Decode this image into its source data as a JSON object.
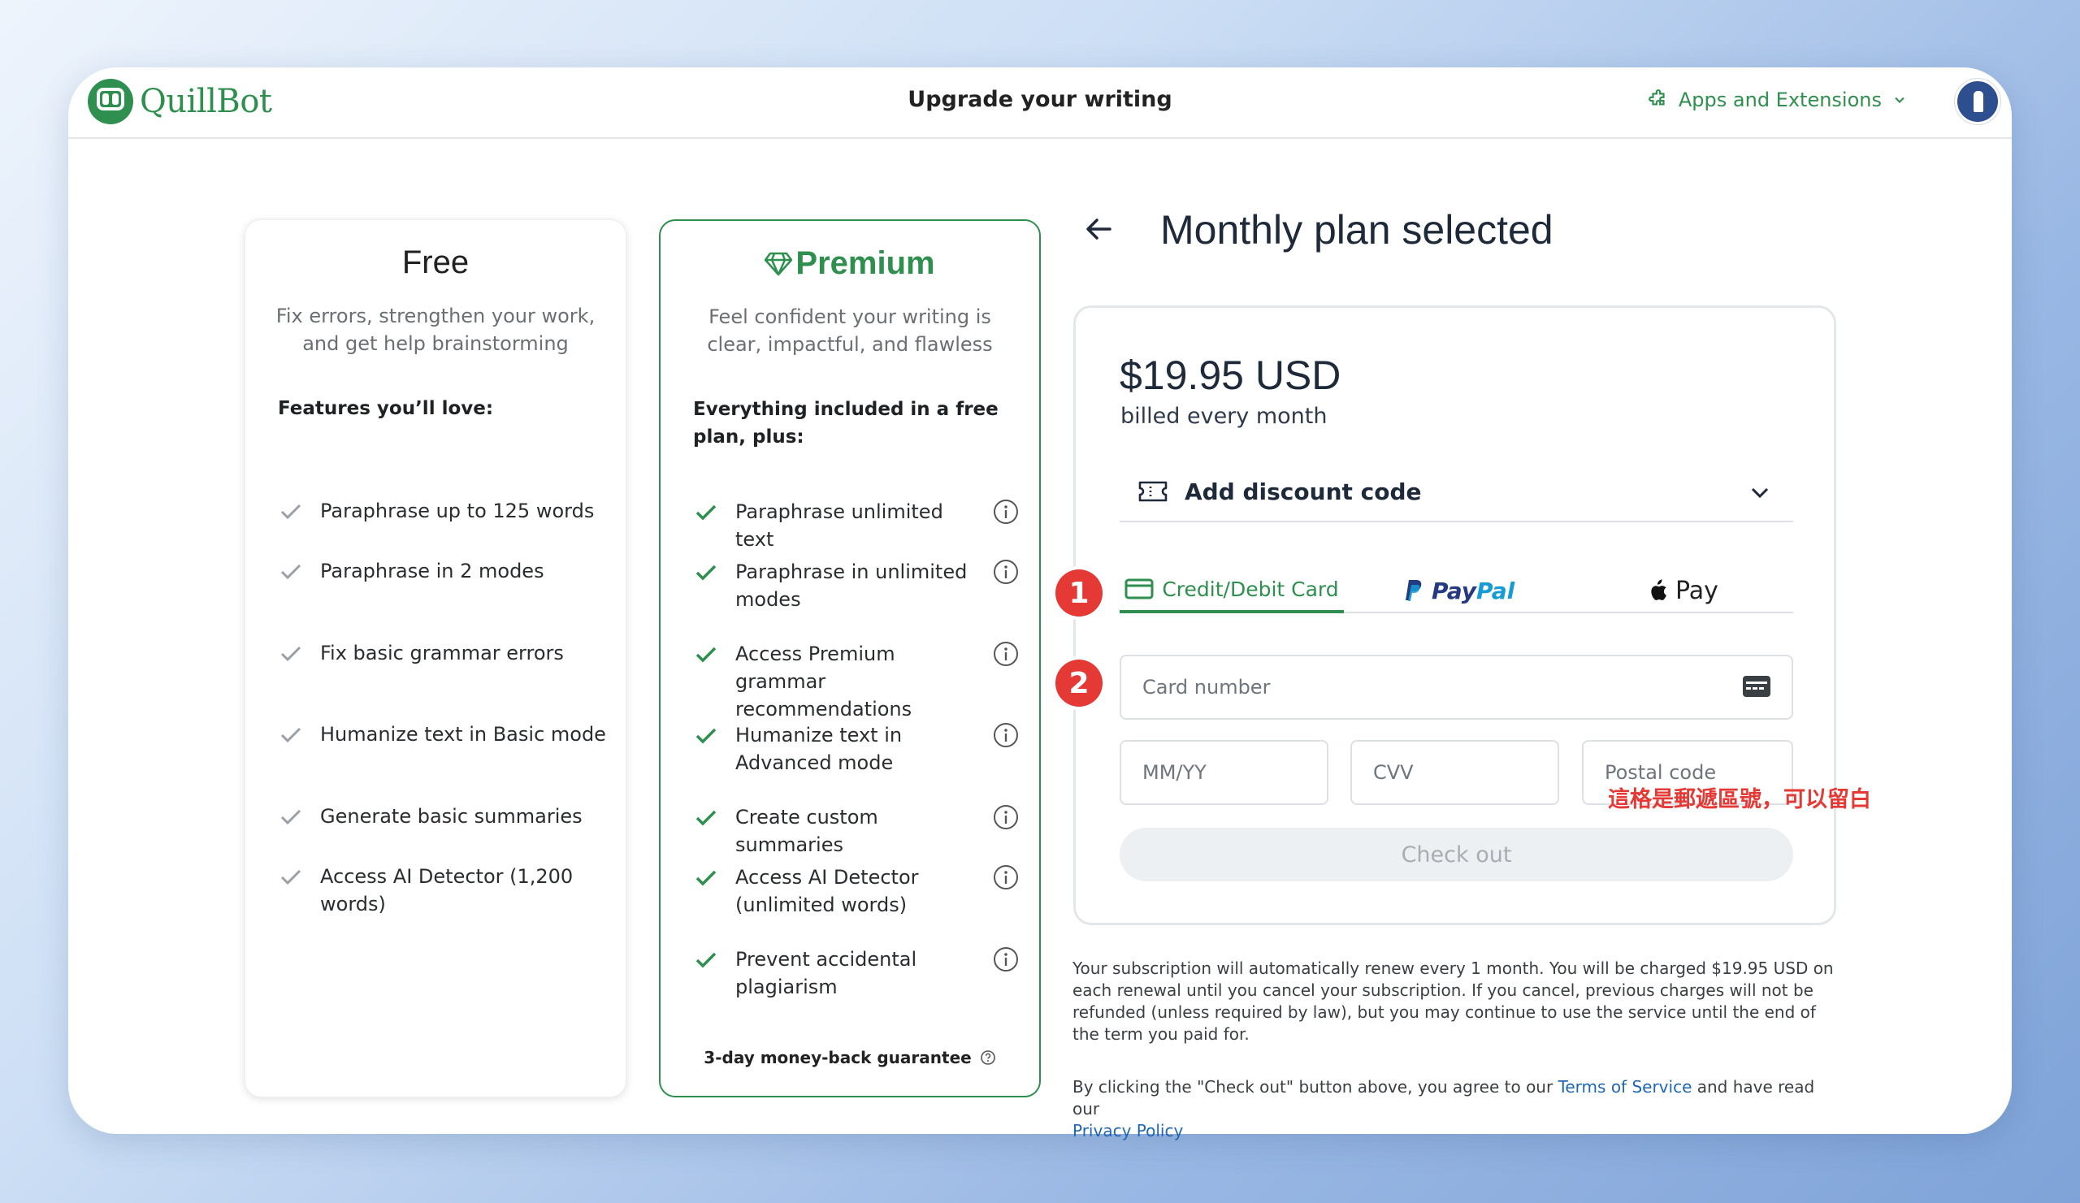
{
  "header": {
    "brand": "QuillBot",
    "title": "Upgrade your writing",
    "apps_label": "Apps and Extensions"
  },
  "free_plan": {
    "name": "Free",
    "description": "Fix errors, strengthen your work, and get help brainstorming",
    "lead": "Features you’ll love:",
    "features": [
      "Paraphrase up to 125 words",
      "Paraphrase in 2 modes",
      "Fix basic grammar errors",
      "Humanize text in Basic mode",
      "Generate basic summaries",
      "Access AI Detector (1,200 words)"
    ]
  },
  "premium_plan": {
    "name": "Premium",
    "description": "Feel confident your writing is clear, impactful, and flawless",
    "lead": "Everything included in a free plan, plus:",
    "features": [
      "Paraphrase unlimited text",
      "Paraphrase in unlimited modes",
      "Access Premium grammar recommendations",
      "Humanize text in Advanced mode",
      "Create custom summaries",
      "Access AI Detector (unlimited words)",
      "Prevent accidental plagiarism"
    ],
    "guarantee": "3-day money-back guarantee"
  },
  "checkout": {
    "title": "Monthly plan selected",
    "price": "$19.95 USD",
    "billing": "billed every month",
    "discount_label": "Add discount code",
    "tabs": {
      "card": "Credit/Debit Card",
      "paypal_1": "Pay",
      "paypal_2": "Pal",
      "apple": "Pay"
    },
    "card_number_placeholder": "Card number",
    "expiry_placeholder": "MM/YY",
    "cvv_placeholder": "CVV",
    "postal_placeholder": "Postal code",
    "button": "Check out",
    "renewal_text": "Your subscription will automatically renew every 1 month. You will be charged $19.95 USD on each renewal until you cancel your subscription. If you cancel, previous charges will not be refunded (unless required by law), but you may continue to use the service until the end of the term you paid for.",
    "agree_prefix": "By clicking the \"Check out\" button above, you agree to our ",
    "terms_link": "Terms of Service",
    "agree_middle": " and have read our ",
    "privacy_link": "Privacy Policy"
  },
  "annotations": {
    "step1": "1",
    "step2": "2",
    "postal_note": "這格是郵遞區號，可以留白",
    "color": "#e53935"
  },
  "colors": {
    "brand_green": "#2f8f4e",
    "link_blue": "#1f66b3"
  }
}
